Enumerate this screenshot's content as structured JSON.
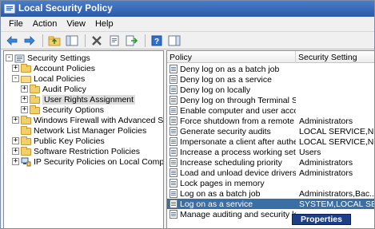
{
  "window": {
    "title": "Local Security Policy"
  },
  "menu": {
    "items": [
      "File",
      "Action",
      "View",
      "Help"
    ]
  },
  "tree": {
    "items": [
      {
        "label": "Security Settings",
        "expander": "-",
        "icon": "security-settings-icon"
      },
      {
        "label": "Account Policies",
        "expander": "+",
        "icon": "folder-icon"
      },
      {
        "label": "Local Policies",
        "expander": "-",
        "icon": "folder-open-icon"
      },
      {
        "label": "Audit Policy",
        "expander": "+",
        "icon": "folder-icon"
      },
      {
        "label": "User Rights Assignment",
        "expander": "+",
        "icon": "folder-icon"
      },
      {
        "label": "Security Options",
        "expander": "+",
        "icon": "folder-icon"
      },
      {
        "label": "Windows Firewall with Advanced Security",
        "expander": "+",
        "icon": "folder-icon"
      },
      {
        "label": "Network List Manager Policies",
        "expander": "",
        "icon": "folder-icon"
      },
      {
        "label": "Public Key Policies",
        "expander": "+",
        "icon": "folder-icon"
      },
      {
        "label": "Software Restriction Policies",
        "expander": "+",
        "icon": "folder-icon"
      },
      {
        "label": "IP Security Policies on Local Computer",
        "expander": "+",
        "icon": "ip-security-icon"
      }
    ]
  },
  "list": {
    "columns": {
      "policy": "Policy",
      "setting": "Security Setting"
    },
    "rows": [
      {
        "policy": "Deny log on as a batch job",
        "setting": ""
      },
      {
        "policy": "Deny log on as a service",
        "setting": ""
      },
      {
        "policy": "Deny log on locally",
        "setting": ""
      },
      {
        "policy": "Deny log on through Terminal Ser...",
        "setting": ""
      },
      {
        "policy": "Enable computer and user accoun...",
        "setting": ""
      },
      {
        "policy": "Force shutdown from a remote sy...",
        "setting": "Administrators"
      },
      {
        "policy": "Generate security audits",
        "setting": "LOCAL SERVICE,NE..."
      },
      {
        "policy": "Impersonate a client after authen...",
        "setting": "LOCAL SERVICE,NE..."
      },
      {
        "policy": "Increase a process working set",
        "setting": "Users"
      },
      {
        "policy": "Increase scheduling priority",
        "setting": "Administrators"
      },
      {
        "policy": "Load and unload device drivers",
        "setting": "Administrators"
      },
      {
        "policy": "Lock pages in memory",
        "setting": ""
      },
      {
        "policy": "Log on as a batch job",
        "setting": "Administrators,Bac..."
      },
      {
        "policy": "Log on as a service",
        "setting": "SYSTEM,LOCAL SER..."
      },
      {
        "policy": "Manage auditing and security log",
        "setting": ""
      }
    ]
  },
  "context_menu": {
    "label": "Properties"
  },
  "colors": {
    "titlebar": "#2a5aa8",
    "selection": "#3a6ea5",
    "context_menu": "#1f3f85"
  }
}
